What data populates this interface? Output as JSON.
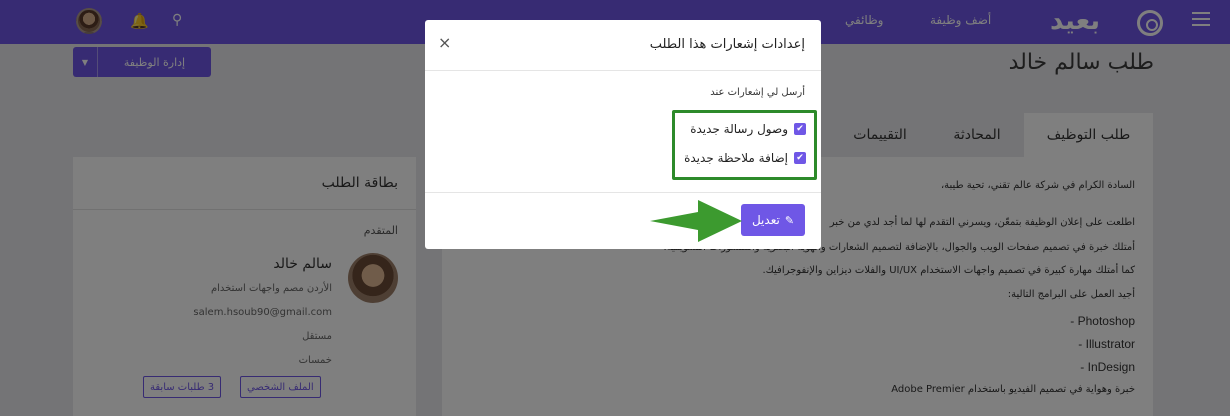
{
  "navbar": {
    "logo_text": "بعيد",
    "links": [
      "أضف وظيفة",
      "وظائفي"
    ]
  },
  "page": {
    "title": "طلب سالم خالد",
    "manage_button": "إدارة الوظيفة"
  },
  "tabs": [
    "طلب التوظيف",
    "المحادثة",
    "التقييمات"
  ],
  "letter": {
    "lines": [
      "السادة الكرام في شركة عالم تقني، تحية طيبة،",
      "اطلعت على إعلان الوظيفة بتمعّن، ويسرني التقدم لها لما أجد لدي من خبر",
      "أمتلك خبرة في تصميم صفحات الويب والجوال، بالإضافة لتصميم الشعارات والهوية البصرية والمنشورات التسويقية.",
      "كما أمتلك مهارة كبيرة في تصميم واجهات الاستخدام UI/UX والفلات ديزاين والإنفوجرافيك.",
      "أجيد العمل على البرامج التالية:",
      "Photoshop -",
      "Illustrator -",
      "InDesign -",
      "خبرة وهواية في تصميم الفيديو باستخدام Adobe Premier"
    ]
  },
  "card": {
    "title": "بطاقة الطلب",
    "subtitle": "المتقدم",
    "name": "سالم خالد",
    "location_role": "الأردن  مصم واجهات استخدام",
    "email": "salem.hsoub90@gmail.com",
    "tag1": "مستقل",
    "tag2": "خمسات",
    "btn_profile": "الملف الشخصي",
    "btn_previous": "3 طلبات سابقة"
  },
  "modal": {
    "title": "إعدادات إشعارات هذا الطلب",
    "description": "أرسل لي إشعارات عند",
    "options": [
      {
        "label": "وصول رسالة جديدة",
        "checked": true
      },
      {
        "label": "إضافة ملاحظة جديدة",
        "checked": true
      }
    ],
    "edit_button": "تعديل",
    "close_glyph": "×"
  },
  "colors": {
    "brand": "#6f57e6",
    "highlight_box": "#2d8a2a",
    "arrow": "#3c9a2f"
  }
}
